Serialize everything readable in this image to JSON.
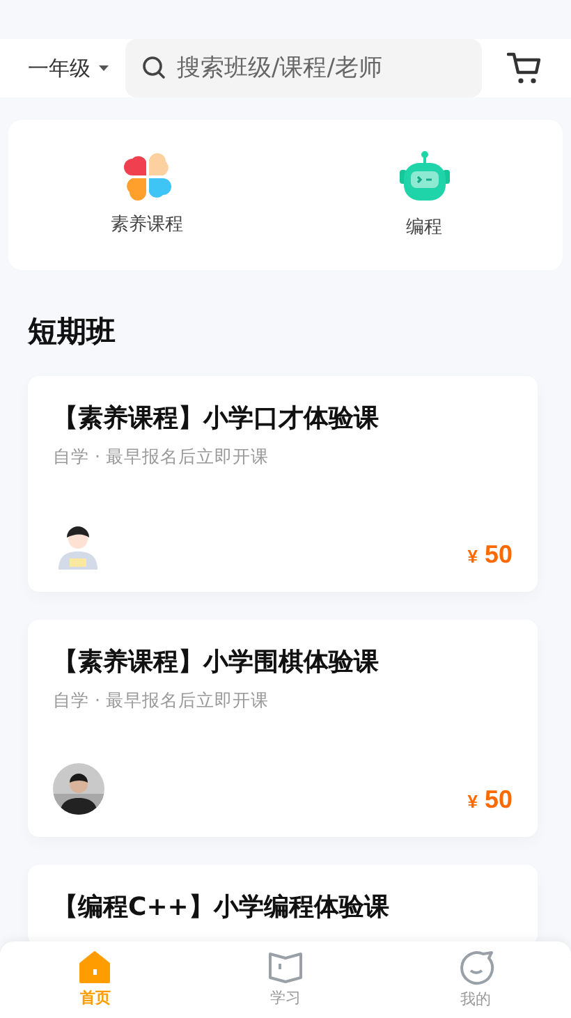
{
  "header": {
    "grade": "一年级",
    "search": {
      "placeholder": "搜索班级/课程/老师"
    }
  },
  "categories": [
    {
      "kind": "petals",
      "label": "素养课程"
    },
    {
      "kind": "robot",
      "label": "编程"
    }
  ],
  "section_title": "短期班",
  "courses": [
    {
      "title": "【素养课程】小学口才体验课",
      "subtitle": "自学 · 最早报名后立即开课",
      "avatar": {
        "kind": "cartoon"
      },
      "currency": "¥",
      "price": "50"
    },
    {
      "title": "【素养课程】小学围棋体验课",
      "subtitle": "自学 · 最早报名后立即开课",
      "currency": "¥",
      "price": "50"
    },
    {
      "title": "【编程C++】小学编程体验课"
    }
  ],
  "tabs": [
    {
      "kind": "home",
      "label": "首页",
      "selected": true
    },
    {
      "kind": "study",
      "label": "学习",
      "selected": false
    },
    {
      "kind": "me",
      "label": "我的",
      "selected": false
    }
  ]
}
